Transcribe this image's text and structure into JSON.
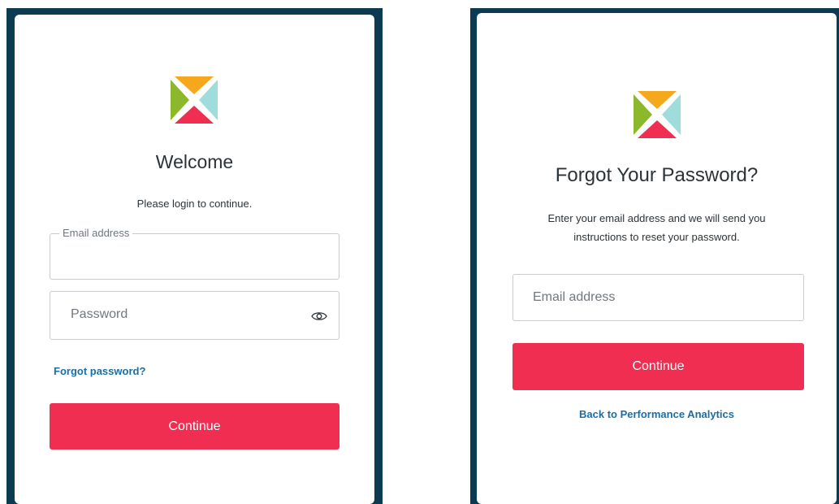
{
  "login": {
    "title": "Welcome",
    "subtitle": "Please login to continue.",
    "email_label": "Email address",
    "email_value": "",
    "password_placeholder": "Password",
    "forgot_link": "Forgot password?",
    "continue_label": "Continue",
    "show_password_icon": "eye-icon"
  },
  "forgot": {
    "title": "Forgot Your Password?",
    "subtitle_line1": "Enter your email address and we will send you",
    "subtitle_line2": "instructions to reset your password.",
    "email_placeholder": "Email address",
    "continue_label": "Continue",
    "back_link": "Back to Performance Analytics"
  },
  "colors": {
    "panel_bg": "#0b3b52",
    "accent": "#ef2e51",
    "link": "#1a6ea5",
    "logo_top": "#f6a81c",
    "logo_left": "#8cb82b",
    "logo_right": "#9fdcdc",
    "logo_bottom": "#ef2e51"
  }
}
